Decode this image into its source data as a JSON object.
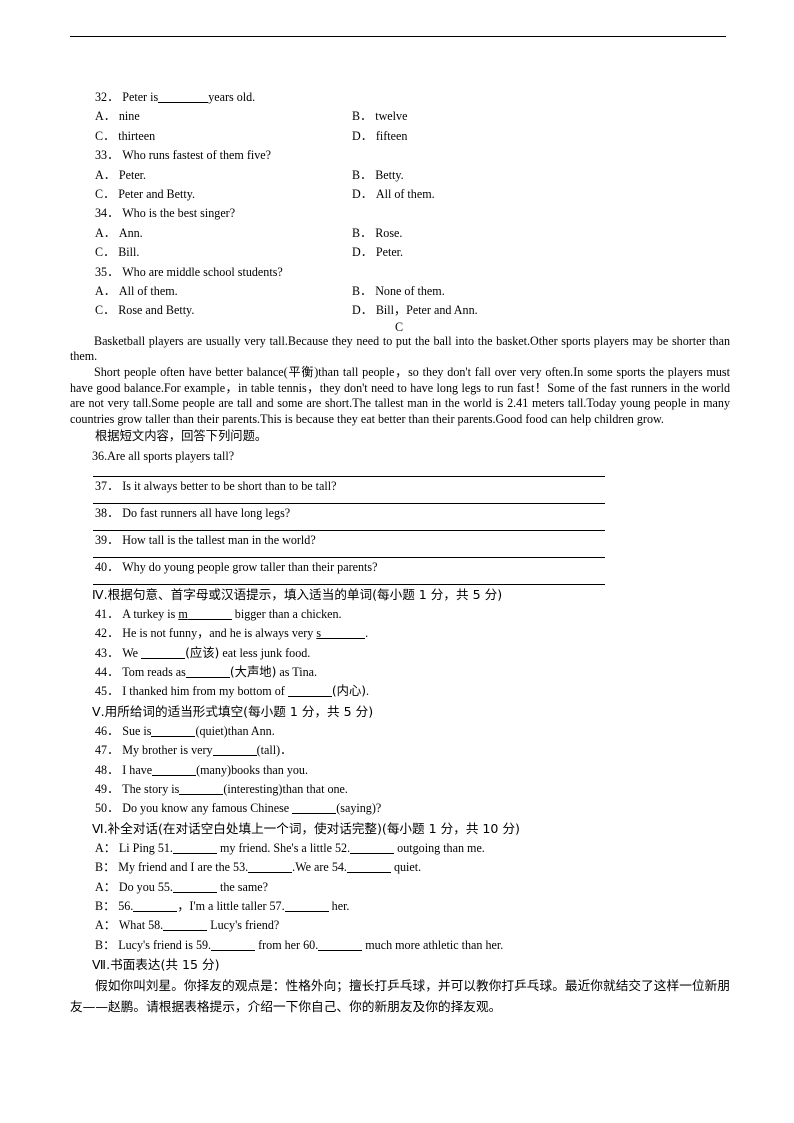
{
  "document": {
    "header_rule": true
  },
  "multiple_choice": [
    {
      "number": "32．",
      "stem_before": "Peter is",
      "stem_after": "years old.",
      "options": [
        {
          "label": "A．",
          "text": "nine"
        },
        {
          "label": "B．",
          "text": "twelve"
        },
        {
          "label": "C．",
          "text": "thirteen"
        },
        {
          "label": "D．",
          "text": "fifteen"
        }
      ]
    },
    {
      "number": "33．",
      "stem": "Who runs fastest of them five?",
      "options": [
        {
          "label": "A．",
          "text": "Peter."
        },
        {
          "label": "B．",
          "text": "Betty."
        },
        {
          "label": "C．",
          "text": "Peter and Betty."
        },
        {
          "label": "D．",
          "text": "All of them."
        }
      ]
    },
    {
      "number": "34．",
      "stem": "Who is the best singer?",
      "options": [
        {
          "label": "A．",
          "text": "Ann."
        },
        {
          "label": "B．",
          "text": "Rose."
        },
        {
          "label": "C．",
          "text": "Bill."
        },
        {
          "label": "D．",
          "text": "Peter."
        }
      ]
    },
    {
      "number": "35．",
      "stem": "Who are middle school students?",
      "options": [
        {
          "label": "A．",
          "text": "All of them."
        },
        {
          "label": "B．",
          "text": "None of them."
        },
        {
          "label": "C．",
          "text": "Rose and Betty."
        },
        {
          "label": "D．",
          "text": "Bill，Peter and Ann."
        }
      ]
    }
  ],
  "passage": {
    "section_mark": "C",
    "paragraphs": [
      "Basketball players are usually very tall.Because they need to put the ball into the basket.Other sports players may be shorter than them.",
      "Short people often have better balance(平衡)than tall people，so they don't fall over very often.In some sports the players must have good balance.For example，in table tennis，they don't need to have long legs to run fast！Some of the fast runners in the world are not very tall.Some people are tall and some are short.The tallest man in the world is 2.41 meters tall.Today young people in many countries grow taller than their parents.This is because they eat better than their parents.Good food can help children grow."
    ],
    "instruction": "根据短文内容，回答下列问题。"
  },
  "short_answer": [
    {
      "number": "36.",
      "question": "Are all sports players tall?"
    },
    {
      "number": "37．",
      "question": "Is it always better to be short than to be tall?"
    },
    {
      "number": "38．",
      "question": "Do fast runners all have long legs?"
    },
    {
      "number": "39．",
      "question": "How tall is the tallest man in the world?"
    },
    {
      "number": "40．",
      "question": "Why do young people grow taller than their parents?"
    }
  ],
  "section_iv": {
    "roman": "Ⅳ",
    "heading": ".根据句意、首字母或汉语提示，填入适当的单词(每小题 1 分，共 5 分)",
    "items": [
      {
        "number": "41．",
        "before": "A turkey is",
        "hint_letter": "m",
        "after": "bigger than a chicken."
      },
      {
        "number": "42．",
        "before": "He is not funny，and he is always very",
        "hint_letter": "s",
        "after": "."
      },
      {
        "number": "43．",
        "before": "We",
        "hint": "(应该)",
        "after": "eat less junk food."
      },
      {
        "number": "44．",
        "before": "Tom reads as",
        "hint": "(大声地)",
        "after": "as Tina."
      },
      {
        "number": "45．",
        "before": "I thanked him from my bottom of",
        "hint": "(内心)",
        "after": "."
      }
    ]
  },
  "section_v": {
    "roman": "Ⅴ",
    "heading": ".用所给词的适当形式填空(每小题 1 分，共 5 分)",
    "items": [
      {
        "number": "46．",
        "before": "Sue is",
        "hint": "(quiet)",
        "after": "than Ann."
      },
      {
        "number": "47．",
        "before": "My brother is very",
        "hint": "(tall)",
        "after": "．"
      },
      {
        "number": "48．",
        "before": "I have",
        "hint": "(many)",
        "after": "books than you."
      },
      {
        "number": "49．",
        "before": "The story is",
        "hint": "(interesting)",
        "after": "than that one."
      },
      {
        "number": "50．",
        "before": "Do you know any famous Chinese",
        "hint": "(saying)",
        "after": "?"
      }
    ]
  },
  "section_vi": {
    "roman": "Ⅵ",
    "heading": ".补全对话(在对话空白处填上一个词，使对话完整)(每小题 1 分，共 10 分)",
    "dialogue": [
      {
        "speaker": "A：",
        "parts": [
          "Li Ping 51.",
          " my friend. She's a little 52.",
          " outgoing than me."
        ]
      },
      {
        "speaker": "B：",
        "parts": [
          "My friend and I are the 53.",
          ".We are 54.",
          " quiet."
        ]
      },
      {
        "speaker": "A：",
        "parts": [
          "Do you 55.",
          " the same?"
        ]
      },
      {
        "speaker": "B：",
        "parts": [
          "56.",
          "，I'm a little taller 57.",
          " her."
        ]
      },
      {
        "speaker": "A：",
        "parts": [
          "What 58.",
          " Lucy's friend?"
        ]
      },
      {
        "speaker": "B：",
        "parts": [
          "Lucy's friend is 59.",
          " from her 60.",
          " much more athletic than her."
        ]
      }
    ]
  },
  "section_vii": {
    "roman": "Ⅶ",
    "heading": ".书面表达(共 15 分)",
    "prompt": "假如你叫刘星。你择友的观点是：性格外向；擅长打乒乓球，并可以教你打乒乓球。最近你就结交了这样一位新朋友——赵鹏。请根据表格提示，介绍一下你自己、你的新朋友及你的择友观。"
  }
}
